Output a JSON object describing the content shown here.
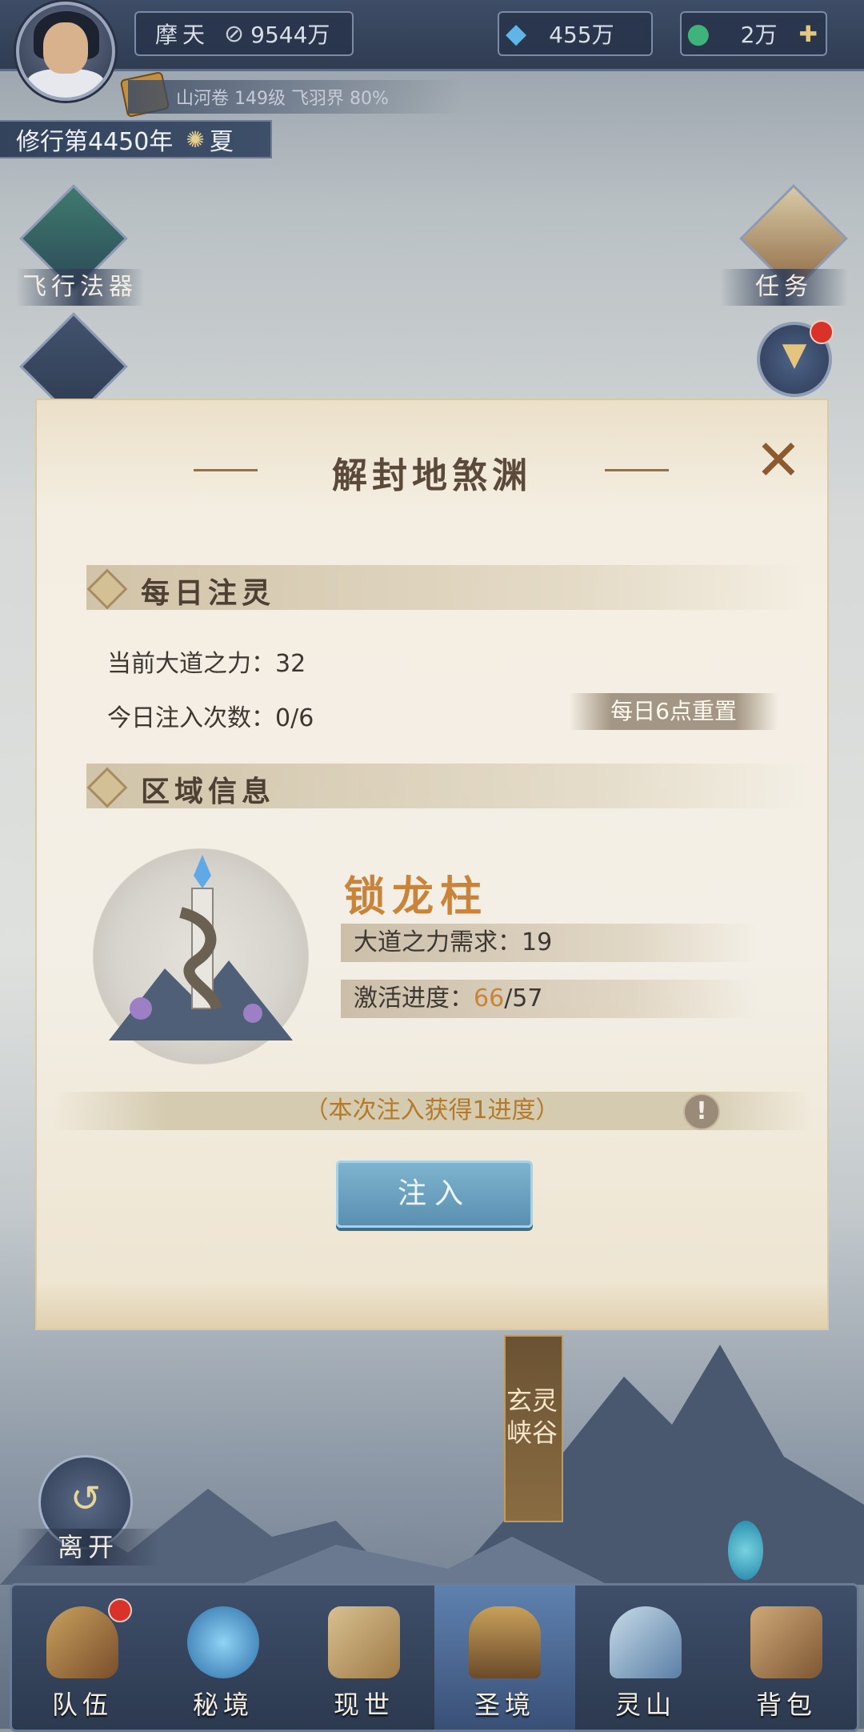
{
  "player": {
    "name": "摩天",
    "power": "9544万",
    "currency1": "455万",
    "currency2": "2万",
    "realm_line": "山河卷 149级 飞羽界 80%",
    "year": "修行第4450年",
    "season": "夏"
  },
  "side_buttons": {
    "flying_artifact": "飞行法器",
    "task": "任务"
  },
  "dialog": {
    "title": "解封地煞渊",
    "daily_section": "每日注灵",
    "current_power_label": "当前大道之力：",
    "current_power_value": "32",
    "inject_count_label": "今日注入次数：",
    "inject_count_value": "0/6",
    "reset_note": "每日6点重置",
    "area_section": "区域信息",
    "pillar_name": "锁龙柱",
    "requirement_label": "大道之力需求：",
    "requirement_value": "19",
    "progress_label": "激活进度：",
    "progress_current": "66",
    "progress_total": "/57",
    "notice": "（本次注入获得1进度）",
    "info_icon": "!",
    "inject_button": "注入",
    "close_icon": "✕"
  },
  "scene": {
    "tower_label": "玄灵峡谷",
    "leave_button": "离开"
  },
  "bottom_nav": [
    {
      "label": "队伍",
      "badge": true
    },
    {
      "label": "秘境",
      "badge": false
    },
    {
      "label": "现世",
      "badge": false
    },
    {
      "label": "圣境",
      "badge": false,
      "active": true
    },
    {
      "label": "灵山",
      "badge": false
    },
    {
      "label": "背包",
      "badge": false
    }
  ],
  "colors": {
    "accent_gold": "#c9843a",
    "button_blue": "#5a8fb0",
    "nav_bg": "#2c394f"
  }
}
